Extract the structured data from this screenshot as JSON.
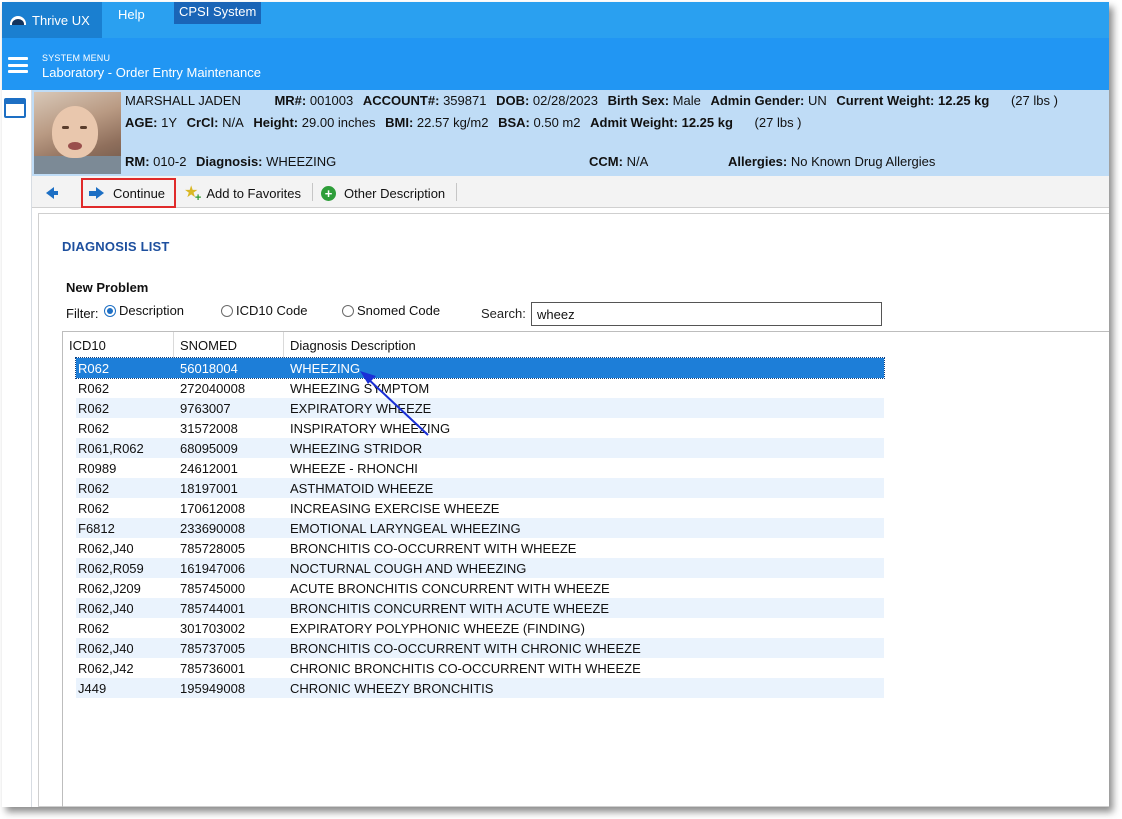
{
  "tabs": {
    "app": "Thrive UX",
    "help": "Help",
    "system": "CPSI System"
  },
  "header": {
    "menu_label": "SYSTEM MENU",
    "subtitle": "Laboratory - Order Entry Maintenance"
  },
  "patient": {
    "name": "MARSHALL JADEN",
    "mr_label": "MR#:",
    "mr": "001003",
    "account_label": "ACCOUNT#:",
    "account": "359871",
    "dob_label": "DOB:",
    "dob": "02/28/2023",
    "birth_sex_label": "Birth Sex:",
    "birth_sex": "Male",
    "admin_gender_label": "Admin Gender:",
    "admin_gender": "UN",
    "current_weight_label": "Current Weight:",
    "current_weight": "12.25 kg",
    "current_weight_lbs": "(27 lbs )",
    "age_label": "AGE:",
    "age": "1Y",
    "crcl_label": "CrCl:",
    "crcl": "N/A",
    "height_label": "Height:",
    "height": "29.00 inches",
    "bmi_label": "BMI:",
    "bmi": "22.57 kg/m2",
    "bsa_label": "BSA:",
    "bsa": "0.50 m2",
    "admit_weight_label": "Admit Weight:",
    "admit_weight": "12.25 kg",
    "admit_weight_lbs": "(27 lbs )",
    "rm_label": "RM:",
    "rm": "010-2",
    "diagnosis_label": "Diagnosis:",
    "diagnosis": "WHEEZING",
    "ccm_label": "CCM:",
    "ccm": "N/A",
    "allergies_label": "Allergies:",
    "allergies": "No Known Drug Allergies"
  },
  "toolbar": {
    "continue": "Continue",
    "favorites": "Add to Favorites",
    "other": "Other Description"
  },
  "page": {
    "title": "DIAGNOSIS LIST",
    "problem_label": "New Problem",
    "filter_label": "Filter:",
    "filter_options": [
      "Description",
      "ICD10 Code",
      "Snomed Code"
    ],
    "filter_selected": "Description",
    "search_label": "Search:",
    "search_value": "wheez"
  },
  "table": {
    "columns": [
      "ICD10",
      "SNOMED",
      "Diagnosis Description"
    ],
    "selected_index": 0,
    "rows": [
      [
        "R062",
        "56018004",
        "WHEEZING"
      ],
      [
        "R062",
        "272040008",
        "WHEEZING SYMPTOM"
      ],
      [
        "R062",
        "9763007",
        "EXPIRATORY WHEEZE"
      ],
      [
        "R062",
        "31572008",
        "INSPIRATORY WHEEZING"
      ],
      [
        "R061,R062",
        "68095009",
        "WHEEZING STRIDOR"
      ],
      [
        "R0989",
        "24612001",
        "WHEEZE - RHONCHI"
      ],
      [
        "R062",
        "18197001",
        "ASTHMATOID WHEEZE"
      ],
      [
        "R062",
        "170612008",
        "INCREASING EXERCISE WHEEZE"
      ],
      [
        "F6812",
        "233690008",
        "EMOTIONAL LARYNGEAL WHEEZING"
      ],
      [
        "R062,J40",
        "785728005",
        "BRONCHITIS CO-OCCURRENT WITH WHEEZE"
      ],
      [
        "R062,R059",
        "161947006",
        "NOCTURNAL COUGH AND WHEEZING"
      ],
      [
        "R062,J209",
        "785745000",
        "ACUTE BRONCHITIS CONCURRENT WITH WHEEZE"
      ],
      [
        "R062,J40",
        "785744001",
        "BRONCHITIS CONCURRENT WITH ACUTE WHEEZE"
      ],
      [
        "R062",
        "301703002",
        "EXPIRATORY POLYPHONIC WHEEZE (FINDING)"
      ],
      [
        "R062,J40",
        "785737005",
        "BRONCHITIS CO-OCCURRENT WITH CHRONIC WHEEZE"
      ],
      [
        "R062,J42",
        "785736001",
        "CHRONIC BRONCHITIS CO-OCCURRENT WITH WHEEZE"
      ],
      [
        "J449",
        "195949008",
        "CHRONIC WHEEZY BRONCHITIS"
      ]
    ]
  },
  "colors": {
    "topbar": "#2aa0f0",
    "header": "#2196f3",
    "banner": "#bfdcf6",
    "selected_row": "#1d7ed8",
    "alt_row": "#eaf3fd",
    "highlight_box": "#e02a2a",
    "title": "#1d4f9e"
  },
  "icons": {
    "menu": "hamburger-icon",
    "window": "window-icon",
    "back": "arrow-left-icon",
    "continue": "arrow-right-icon",
    "favorites": "star-add-icon",
    "other": "plus-circle-icon"
  }
}
